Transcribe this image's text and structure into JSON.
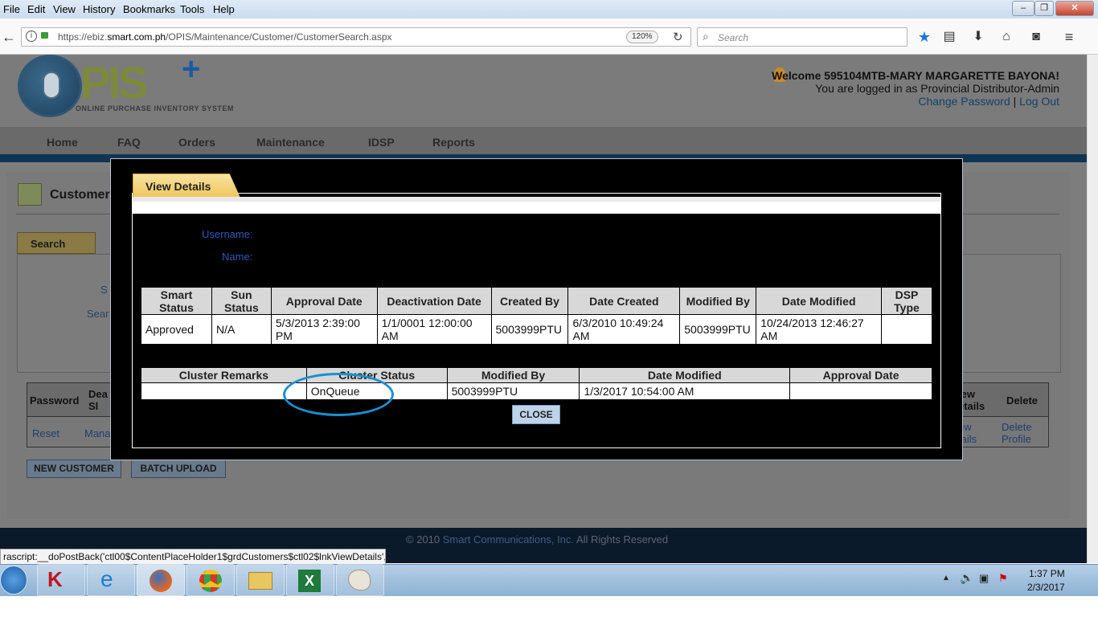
{
  "menubar": {
    "items": [
      "File",
      "Edit",
      "View",
      "History",
      "Bookmarks",
      "Tools",
      "Help"
    ]
  },
  "window_controls": {
    "minimize": "–",
    "maximize": "❐",
    "close": "✕"
  },
  "address": {
    "url_prefix": "https://ebiz.",
    "url_domain": "smart.com.ph",
    "url_path": "/OPIS/Maintenance/Customer/CustomerSearch.aspx",
    "zoom": "120%"
  },
  "search": {
    "placeholder": "Search"
  },
  "site": {
    "logo_text": "PIS",
    "logo_sub": "ONLINE PURCHASE INVENTORY SYSTEM",
    "welcome": "Welcome 595104MTB-MARY MARGARETTE BAYONA!",
    "logged_in_as": "You are logged in as Provincial Distributor-Admin",
    "change_password": "Change Password",
    "separator": "|",
    "log_out": "Log Out"
  },
  "nav": {
    "tabs": [
      "Home",
      "FAQ",
      "Orders",
      "Maintenance",
      "IDSP",
      "Reports"
    ]
  },
  "background_page": {
    "title": "Customer",
    "search_tab": "Search",
    "label_s": "S",
    "label_sear": "Sear",
    "grid_headers": [
      "Password",
      "Dea Sl",
      "iew etails",
      "Delete"
    ],
    "grid_row": [
      "Reset",
      "Mana",
      "ew tails",
      "Delete Profile"
    ],
    "new_customer": "NEW CUSTOMER",
    "batch_upload": "BATCH UPLOAD",
    "footer_copy": "© 2010",
    "footer_company": "Smart Communications, Inc.",
    "footer_rights": "All Rights Reserved"
  },
  "modal": {
    "tab": "View Details",
    "username_label": "Username:",
    "name_label": "Name:",
    "table1": {
      "headers": [
        "Smart Status",
        "Sun Status",
        "Approval Date",
        "Deactivation Date",
        "Created By",
        "Date Created",
        "Modified By",
        "Date Modified",
        "DSP Type"
      ],
      "row": [
        "Approved",
        "N/A",
        "5/3/2013 2:39:00 PM",
        "1/1/0001 12:00:00 AM",
        "5003999PTU",
        "6/3/2010 10:49:24 AM",
        "5003999PTU",
        "10/24/2013 12:46:27 AM",
        ""
      ]
    },
    "table2": {
      "headers": [
        "Cluster Remarks",
        "Cluster Status",
        "Modified By",
        "Date Modified",
        "Approval Date"
      ],
      "row": [
        "",
        "OnQueue",
        "5003999PTU",
        "1/3/2017 10:54:00 AM",
        ""
      ]
    },
    "close": "CLOSE"
  },
  "status_url": "rascript:__doPostBack('ctl00$ContentPlaceHolder1$grdCustomers$ctl02$lnkViewDetails','')",
  "taskbar": {
    "time": "1:37 PM",
    "date": "2/3/2017"
  },
  "colors": {
    "accent": "#0f3555",
    "tab_gold": "#efc55b",
    "link_blue": "#1e5fa8",
    "highlight_circle": "#1a8fd0"
  }
}
